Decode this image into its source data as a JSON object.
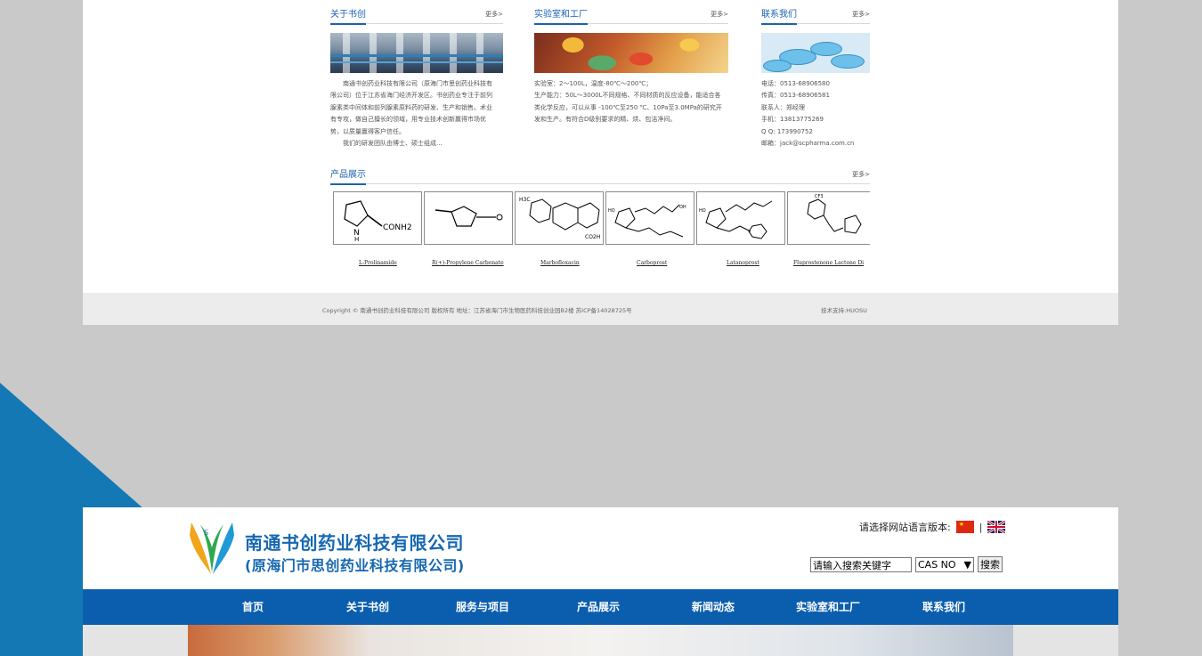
{
  "about": {
    "title": "关于书创",
    "more": "更多>",
    "text": [
      "南通书创药业科技有限公司（原海门市思创药业科技有",
      "限公司）位于江苏省海门经济开发区。书创药业专注于前列",
      "腺素类中间体和前列腺素原料药的研发、生产和销售。术业",
      "有专攻，做自己擅长的领域，用专业技术创新赢得市场优",
      "势，以质量赢得客户信任。",
      "我们的研发团队由博士、硕士组成..."
    ]
  },
  "lab": {
    "title": "实验室和工厂",
    "more": "更多>",
    "text": [
      "实验室：2～100L，温度-80℃～200℃；",
      "生产能力：50L～3000L不同规格、不同材质的反应设备，能适合各",
      "类化学反应，可以从事 -100℃至250 ℃、10Pa至3.0MPa的研究开",
      "发和生产。有符合D级别要求的精、烘、包洁净间。"
    ]
  },
  "contact": {
    "title": "联系我们",
    "more": "更多>",
    "lines": [
      "电话：0513-68906580",
      "传真：0513-68906581",
      "联系人：郑经理",
      "手机：13813775269",
      "Q   Q: 173990752",
      "邮箱：jack@scpharma.com.cn"
    ]
  },
  "products": {
    "title": "产品展示",
    "more": "更多>",
    "items": [
      {
        "name": "L-Prolinamide",
        "img_text": "CONH2"
      },
      {
        "name": "R(+)-Propylene Carbonate"
      },
      {
        "name": "Marbofloxacin"
      },
      {
        "name": "Carboprost"
      },
      {
        "name": "Latanoprost"
      },
      {
        "name": "Fluprostenone Lactone Di"
      }
    ]
  },
  "footer": {
    "copyright": "Copyright © 南通书创药业科技有限公司 版权所有 地址：江苏省海门市生物医药科技创业园B2楼 苏ICP备14028725号",
    "tech": "技术支持:HUOSU"
  },
  "header": {
    "brand_line1": "南通书创药业科技有限公司",
    "brand_line2": "(原海门市思创药业科技有限公司)",
    "language_label": "请选择网站语言版本:",
    "separator": "|",
    "search_placeholder": "请输入搜索关键字",
    "search_select": "CAS NO",
    "search_button": "搜索"
  },
  "nav": [
    "首页",
    "关于书创",
    "服务与项目",
    "产品展示",
    "新闻动态",
    "实验室和工厂",
    "联系我们"
  ],
  "colors": {
    "primary": "#0b5eae",
    "link": "#1b62b0",
    "background": "#c9c9c9",
    "accent_triangle": "#1478b4"
  }
}
